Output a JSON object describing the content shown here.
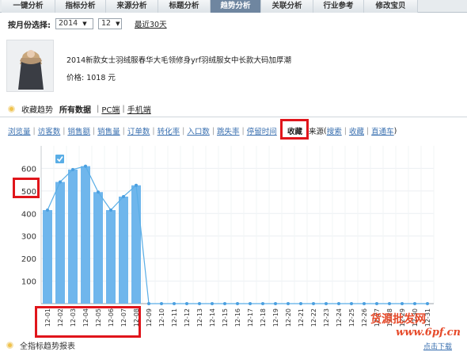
{
  "tabs": [
    "一键分析",
    "指标分析",
    "来源分析",
    "标题分析",
    "趋势分析",
    "关联分析",
    "行业参考",
    "修改宝贝"
  ],
  "active_tab": "趋势分析",
  "month_selector": {
    "label": "按月份选择:",
    "year": "2014",
    "month": "12",
    "last30": "最近30天"
  },
  "product": {
    "title": "2014新款女士羽绒服春华大毛领修身yrf羽绒服女中长款大码加厚潮",
    "price": "价格: 1018 元"
  },
  "section": {
    "title": "收藏趋势",
    "all_data": "所有数据",
    "pc": "PC端",
    "mobile": "手机端"
  },
  "metrics": [
    "浏览量",
    "访客数",
    "销售额",
    "销售量",
    "订单数",
    "转化率",
    "入口数",
    "跳失率",
    "停留时间"
  ],
  "active_metric": "收藏",
  "source": {
    "label": "来源",
    "items": [
      "搜索",
      "收藏",
      "直通车"
    ]
  },
  "chart_data": {
    "type": "bar",
    "categories": [
      "12-01",
      "12-02",
      "12-03",
      "12-04",
      "12-05",
      "12-06",
      "12-07",
      "12-08",
      "12-09",
      "12-10",
      "12-11",
      "12-12",
      "12-13",
      "12-14",
      "12-15",
      "12-16",
      "12-17",
      "12-18",
      "12-19",
      "12-20",
      "12-21",
      "12-22",
      "12-23",
      "12-24",
      "12-25",
      "12-26",
      "12-27",
      "12-28",
      "12-29",
      "12-30",
      "12-31"
    ],
    "values": [
      415,
      540,
      595,
      610,
      495,
      415,
      475,
      525,
      0,
      0,
      0,
      0,
      0,
      0,
      0,
      0,
      0,
      0,
      0,
      0,
      0,
      0,
      0,
      0,
      0,
      0,
      0,
      0,
      0,
      0,
      0
    ],
    "yticks": [
      100,
      200,
      300,
      400,
      500,
      600
    ],
    "ylim": [
      0,
      700
    ],
    "bar_color": "#6fb6ec",
    "line_color": "#5aaee6"
  },
  "footer": {
    "title": "全指标趋势报表",
    "download": "点击下载"
  },
  "watermark": {
    "text": "货源批发网",
    "url": "www.6pf.cn"
  },
  "colors": {
    "highlight_box": "#e0151b",
    "active_tab_bg": "#6f86a0"
  }
}
